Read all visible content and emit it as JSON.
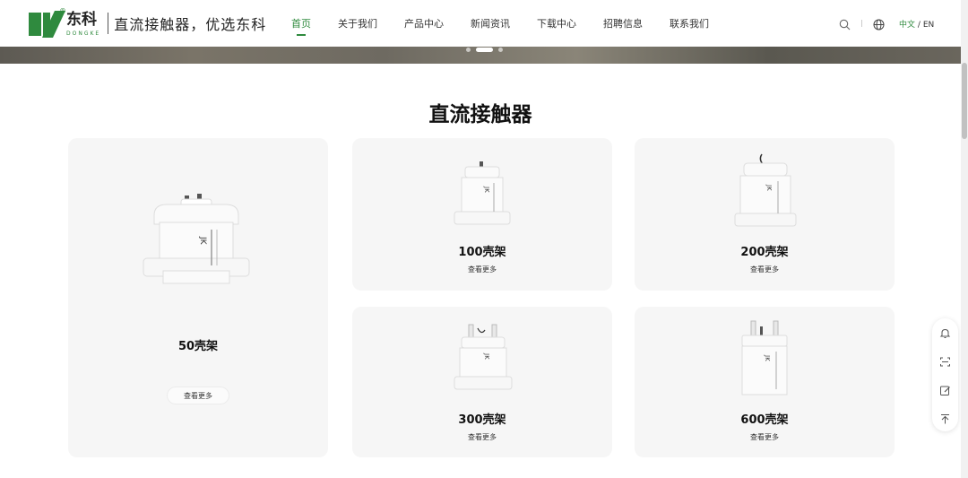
{
  "header": {
    "logo_cn": "东科",
    "logo_en": "DONGKE",
    "logo_reg": "®",
    "slogan": "直流接触器，优选东科",
    "nav": [
      {
        "label": "首页",
        "active": true
      },
      {
        "label": "关于我们",
        "active": false
      },
      {
        "label": "产品中心",
        "active": false
      },
      {
        "label": "新闻资讯",
        "active": false
      },
      {
        "label": "下载中心",
        "active": false
      },
      {
        "label": "招聘信息",
        "active": false
      },
      {
        "label": "联系我们",
        "active": false
      }
    ],
    "icons": [
      "search-icon",
      "globe-icon"
    ],
    "lang_zh": "中文",
    "lang_sep": "/",
    "lang_en": "EN"
  },
  "banner": {
    "slide_count": 3,
    "active_slide": 2
  },
  "section": {
    "title": "直流接触器"
  },
  "products": [
    {
      "label": "50壳架",
      "more": "查看更多"
    },
    {
      "label": "100壳架",
      "more": "查看更多"
    },
    {
      "label": "200壳架",
      "more": "查看更多"
    },
    {
      "label": "300壳架",
      "more": "查看更多"
    },
    {
      "label": "600壳架",
      "more": "查看更多"
    }
  ],
  "float_toolbar": {
    "icons": [
      "bell-icon",
      "scan-icon",
      "edit-icon",
      "back-to-top-icon"
    ]
  },
  "colors": {
    "brand_green": "#2f8a3e",
    "card_bg": "#f6f6f6"
  }
}
